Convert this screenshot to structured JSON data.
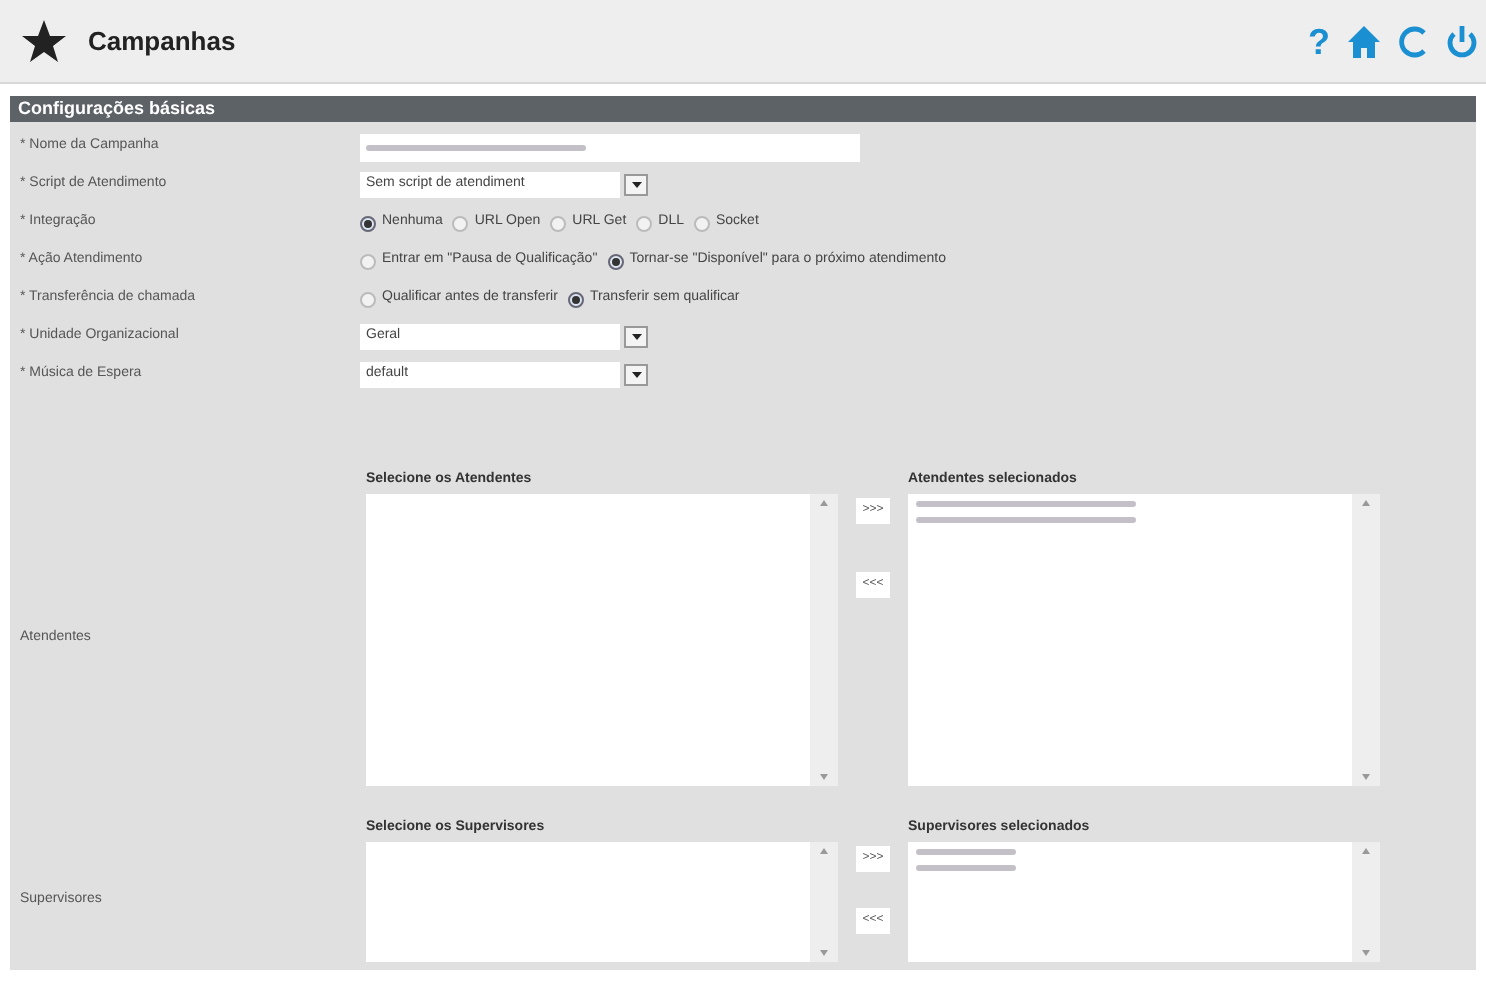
{
  "header": {
    "title": "Campanhas",
    "icons": [
      {
        "kind": "help",
        "text": "?"
      },
      {
        "kind": "home"
      },
      {
        "kind": "refresh"
      },
      {
        "kind": "power"
      }
    ]
  },
  "section": {
    "title": "Configurações básicas"
  },
  "fields": [
    {
      "kind": "text",
      "label": "* Nome da Campanha"
    },
    {
      "kind": "select",
      "label": "* Script de Atendimento",
      "value": "Sem script de atendiment"
    },
    {
      "kind": "radio",
      "label": "* Integração",
      "options": [
        {
          "label": "Nenhuma",
          "selected": true
        },
        {
          "label": "URL Open",
          "selected": false
        },
        {
          "label": "URL Get",
          "selected": false
        },
        {
          "label": "DLL",
          "selected": false
        },
        {
          "label": "Socket",
          "selected": false
        }
      ]
    },
    {
      "kind": "radio",
      "label": "* Ação Atendimento",
      "options": [
        {
          "label": "Entrar em \"Pausa de Qualificação\"",
          "selected": false
        },
        {
          "label": "Tornar-se \"Disponível\" para o próximo atendimento",
          "selected": true
        }
      ]
    },
    {
      "kind": "radio",
      "label": "* Transferência de chamada",
      "options": [
        {
          "label": "Qualificar antes de transferir",
          "selected": false
        },
        {
          "label": "Transferir sem qualificar",
          "selected": true
        }
      ]
    },
    {
      "kind": "select",
      "label": "* Unidade Organizacional",
      "value": "Geral"
    },
    {
      "kind": "select",
      "label": "* Música de Espera",
      "value": "default"
    }
  ],
  "pickers": [
    {
      "label": "Atendentes",
      "available_title": "Selecione os Atendentes",
      "selected_title": "Atendentes selecionados",
      "add": ">>>",
      "remove": "<<<"
    },
    {
      "label": "Supervisores",
      "available_title": "Selecione os Supervisores",
      "selected_title": "Supervisores selecionados",
      "add": ">>>",
      "remove": "<<<"
    }
  ]
}
